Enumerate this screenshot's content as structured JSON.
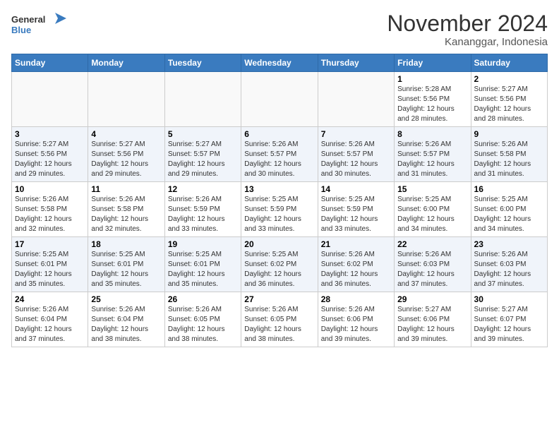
{
  "header": {
    "logo_line1": "General",
    "logo_line2": "Blue",
    "title": "November 2024",
    "subtitle": "Kananggar, Indonesia"
  },
  "weekdays": [
    "Sunday",
    "Monday",
    "Tuesday",
    "Wednesday",
    "Thursday",
    "Friday",
    "Saturday"
  ],
  "weeks": [
    [
      {
        "day": "",
        "info": ""
      },
      {
        "day": "",
        "info": ""
      },
      {
        "day": "",
        "info": ""
      },
      {
        "day": "",
        "info": ""
      },
      {
        "day": "",
        "info": ""
      },
      {
        "day": "1",
        "info": "Sunrise: 5:28 AM\nSunset: 5:56 PM\nDaylight: 12 hours\nand 28 minutes."
      },
      {
        "day": "2",
        "info": "Sunrise: 5:27 AM\nSunset: 5:56 PM\nDaylight: 12 hours\nand 28 minutes."
      }
    ],
    [
      {
        "day": "3",
        "info": "Sunrise: 5:27 AM\nSunset: 5:56 PM\nDaylight: 12 hours\nand 29 minutes."
      },
      {
        "day": "4",
        "info": "Sunrise: 5:27 AM\nSunset: 5:56 PM\nDaylight: 12 hours\nand 29 minutes."
      },
      {
        "day": "5",
        "info": "Sunrise: 5:27 AM\nSunset: 5:57 PM\nDaylight: 12 hours\nand 29 minutes."
      },
      {
        "day": "6",
        "info": "Sunrise: 5:26 AM\nSunset: 5:57 PM\nDaylight: 12 hours\nand 30 minutes."
      },
      {
        "day": "7",
        "info": "Sunrise: 5:26 AM\nSunset: 5:57 PM\nDaylight: 12 hours\nand 30 minutes."
      },
      {
        "day": "8",
        "info": "Sunrise: 5:26 AM\nSunset: 5:57 PM\nDaylight: 12 hours\nand 31 minutes."
      },
      {
        "day": "9",
        "info": "Sunrise: 5:26 AM\nSunset: 5:58 PM\nDaylight: 12 hours\nand 31 minutes."
      }
    ],
    [
      {
        "day": "10",
        "info": "Sunrise: 5:26 AM\nSunset: 5:58 PM\nDaylight: 12 hours\nand 32 minutes."
      },
      {
        "day": "11",
        "info": "Sunrise: 5:26 AM\nSunset: 5:58 PM\nDaylight: 12 hours\nand 32 minutes."
      },
      {
        "day": "12",
        "info": "Sunrise: 5:26 AM\nSunset: 5:59 PM\nDaylight: 12 hours\nand 33 minutes."
      },
      {
        "day": "13",
        "info": "Sunrise: 5:25 AM\nSunset: 5:59 PM\nDaylight: 12 hours\nand 33 minutes."
      },
      {
        "day": "14",
        "info": "Sunrise: 5:25 AM\nSunset: 5:59 PM\nDaylight: 12 hours\nand 33 minutes."
      },
      {
        "day": "15",
        "info": "Sunrise: 5:25 AM\nSunset: 6:00 PM\nDaylight: 12 hours\nand 34 minutes."
      },
      {
        "day": "16",
        "info": "Sunrise: 5:25 AM\nSunset: 6:00 PM\nDaylight: 12 hours\nand 34 minutes."
      }
    ],
    [
      {
        "day": "17",
        "info": "Sunrise: 5:25 AM\nSunset: 6:01 PM\nDaylight: 12 hours\nand 35 minutes."
      },
      {
        "day": "18",
        "info": "Sunrise: 5:25 AM\nSunset: 6:01 PM\nDaylight: 12 hours\nand 35 minutes."
      },
      {
        "day": "19",
        "info": "Sunrise: 5:25 AM\nSunset: 6:01 PM\nDaylight: 12 hours\nand 35 minutes."
      },
      {
        "day": "20",
        "info": "Sunrise: 5:25 AM\nSunset: 6:02 PM\nDaylight: 12 hours\nand 36 minutes."
      },
      {
        "day": "21",
        "info": "Sunrise: 5:26 AM\nSunset: 6:02 PM\nDaylight: 12 hours\nand 36 minutes."
      },
      {
        "day": "22",
        "info": "Sunrise: 5:26 AM\nSunset: 6:03 PM\nDaylight: 12 hours\nand 37 minutes."
      },
      {
        "day": "23",
        "info": "Sunrise: 5:26 AM\nSunset: 6:03 PM\nDaylight: 12 hours\nand 37 minutes."
      }
    ],
    [
      {
        "day": "24",
        "info": "Sunrise: 5:26 AM\nSunset: 6:04 PM\nDaylight: 12 hours\nand 37 minutes."
      },
      {
        "day": "25",
        "info": "Sunrise: 5:26 AM\nSunset: 6:04 PM\nDaylight: 12 hours\nand 38 minutes."
      },
      {
        "day": "26",
        "info": "Sunrise: 5:26 AM\nSunset: 6:05 PM\nDaylight: 12 hours\nand 38 minutes."
      },
      {
        "day": "27",
        "info": "Sunrise: 5:26 AM\nSunset: 6:05 PM\nDaylight: 12 hours\nand 38 minutes."
      },
      {
        "day": "28",
        "info": "Sunrise: 5:26 AM\nSunset: 6:06 PM\nDaylight: 12 hours\nand 39 minutes."
      },
      {
        "day": "29",
        "info": "Sunrise: 5:27 AM\nSunset: 6:06 PM\nDaylight: 12 hours\nand 39 minutes."
      },
      {
        "day": "30",
        "info": "Sunrise: 5:27 AM\nSunset: 6:07 PM\nDaylight: 12 hours\nand 39 minutes."
      }
    ]
  ]
}
